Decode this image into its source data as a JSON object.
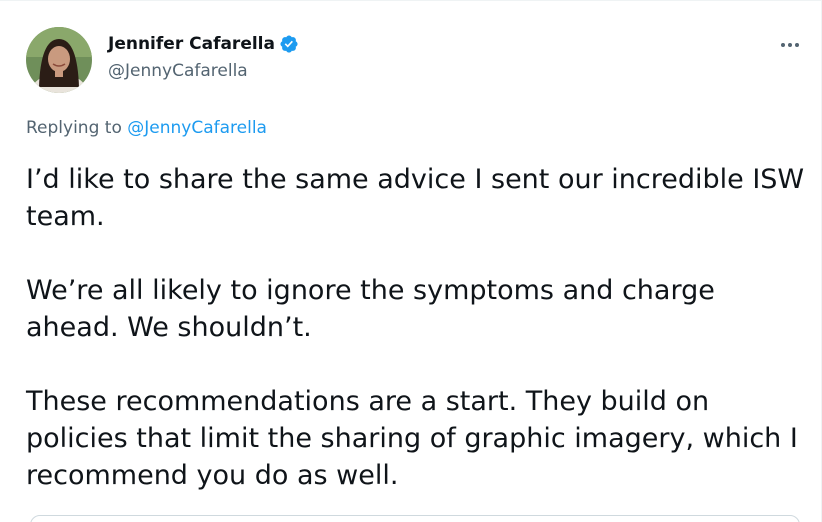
{
  "tweet": {
    "author": {
      "display_name": "Jennifer Cafarella",
      "handle": "@JennyCafarella",
      "verified": true,
      "verified_icon": "verified-badge-icon",
      "avatar_icon": "profile-photo"
    },
    "more_icon": "more-options-icon",
    "replying_prefix": "Replying to ",
    "replying_mention": "@JennyCafarella",
    "paragraphs": [
      "I’d like to share the same advice I sent our incredible ISW team.",
      "We’re all likely to ignore the symptoms and charge ahead. We shouldn’t.",
      "These recommendations are a start. They build on policies that limit the sharing of graphic imagery, which I recommend you do as well."
    ]
  },
  "colors": {
    "text_primary": "#0f1419",
    "text_secondary": "#536471",
    "link": "#1d9bf0",
    "verified_badge": "#1d9bf0",
    "border": "#cfd9de"
  }
}
